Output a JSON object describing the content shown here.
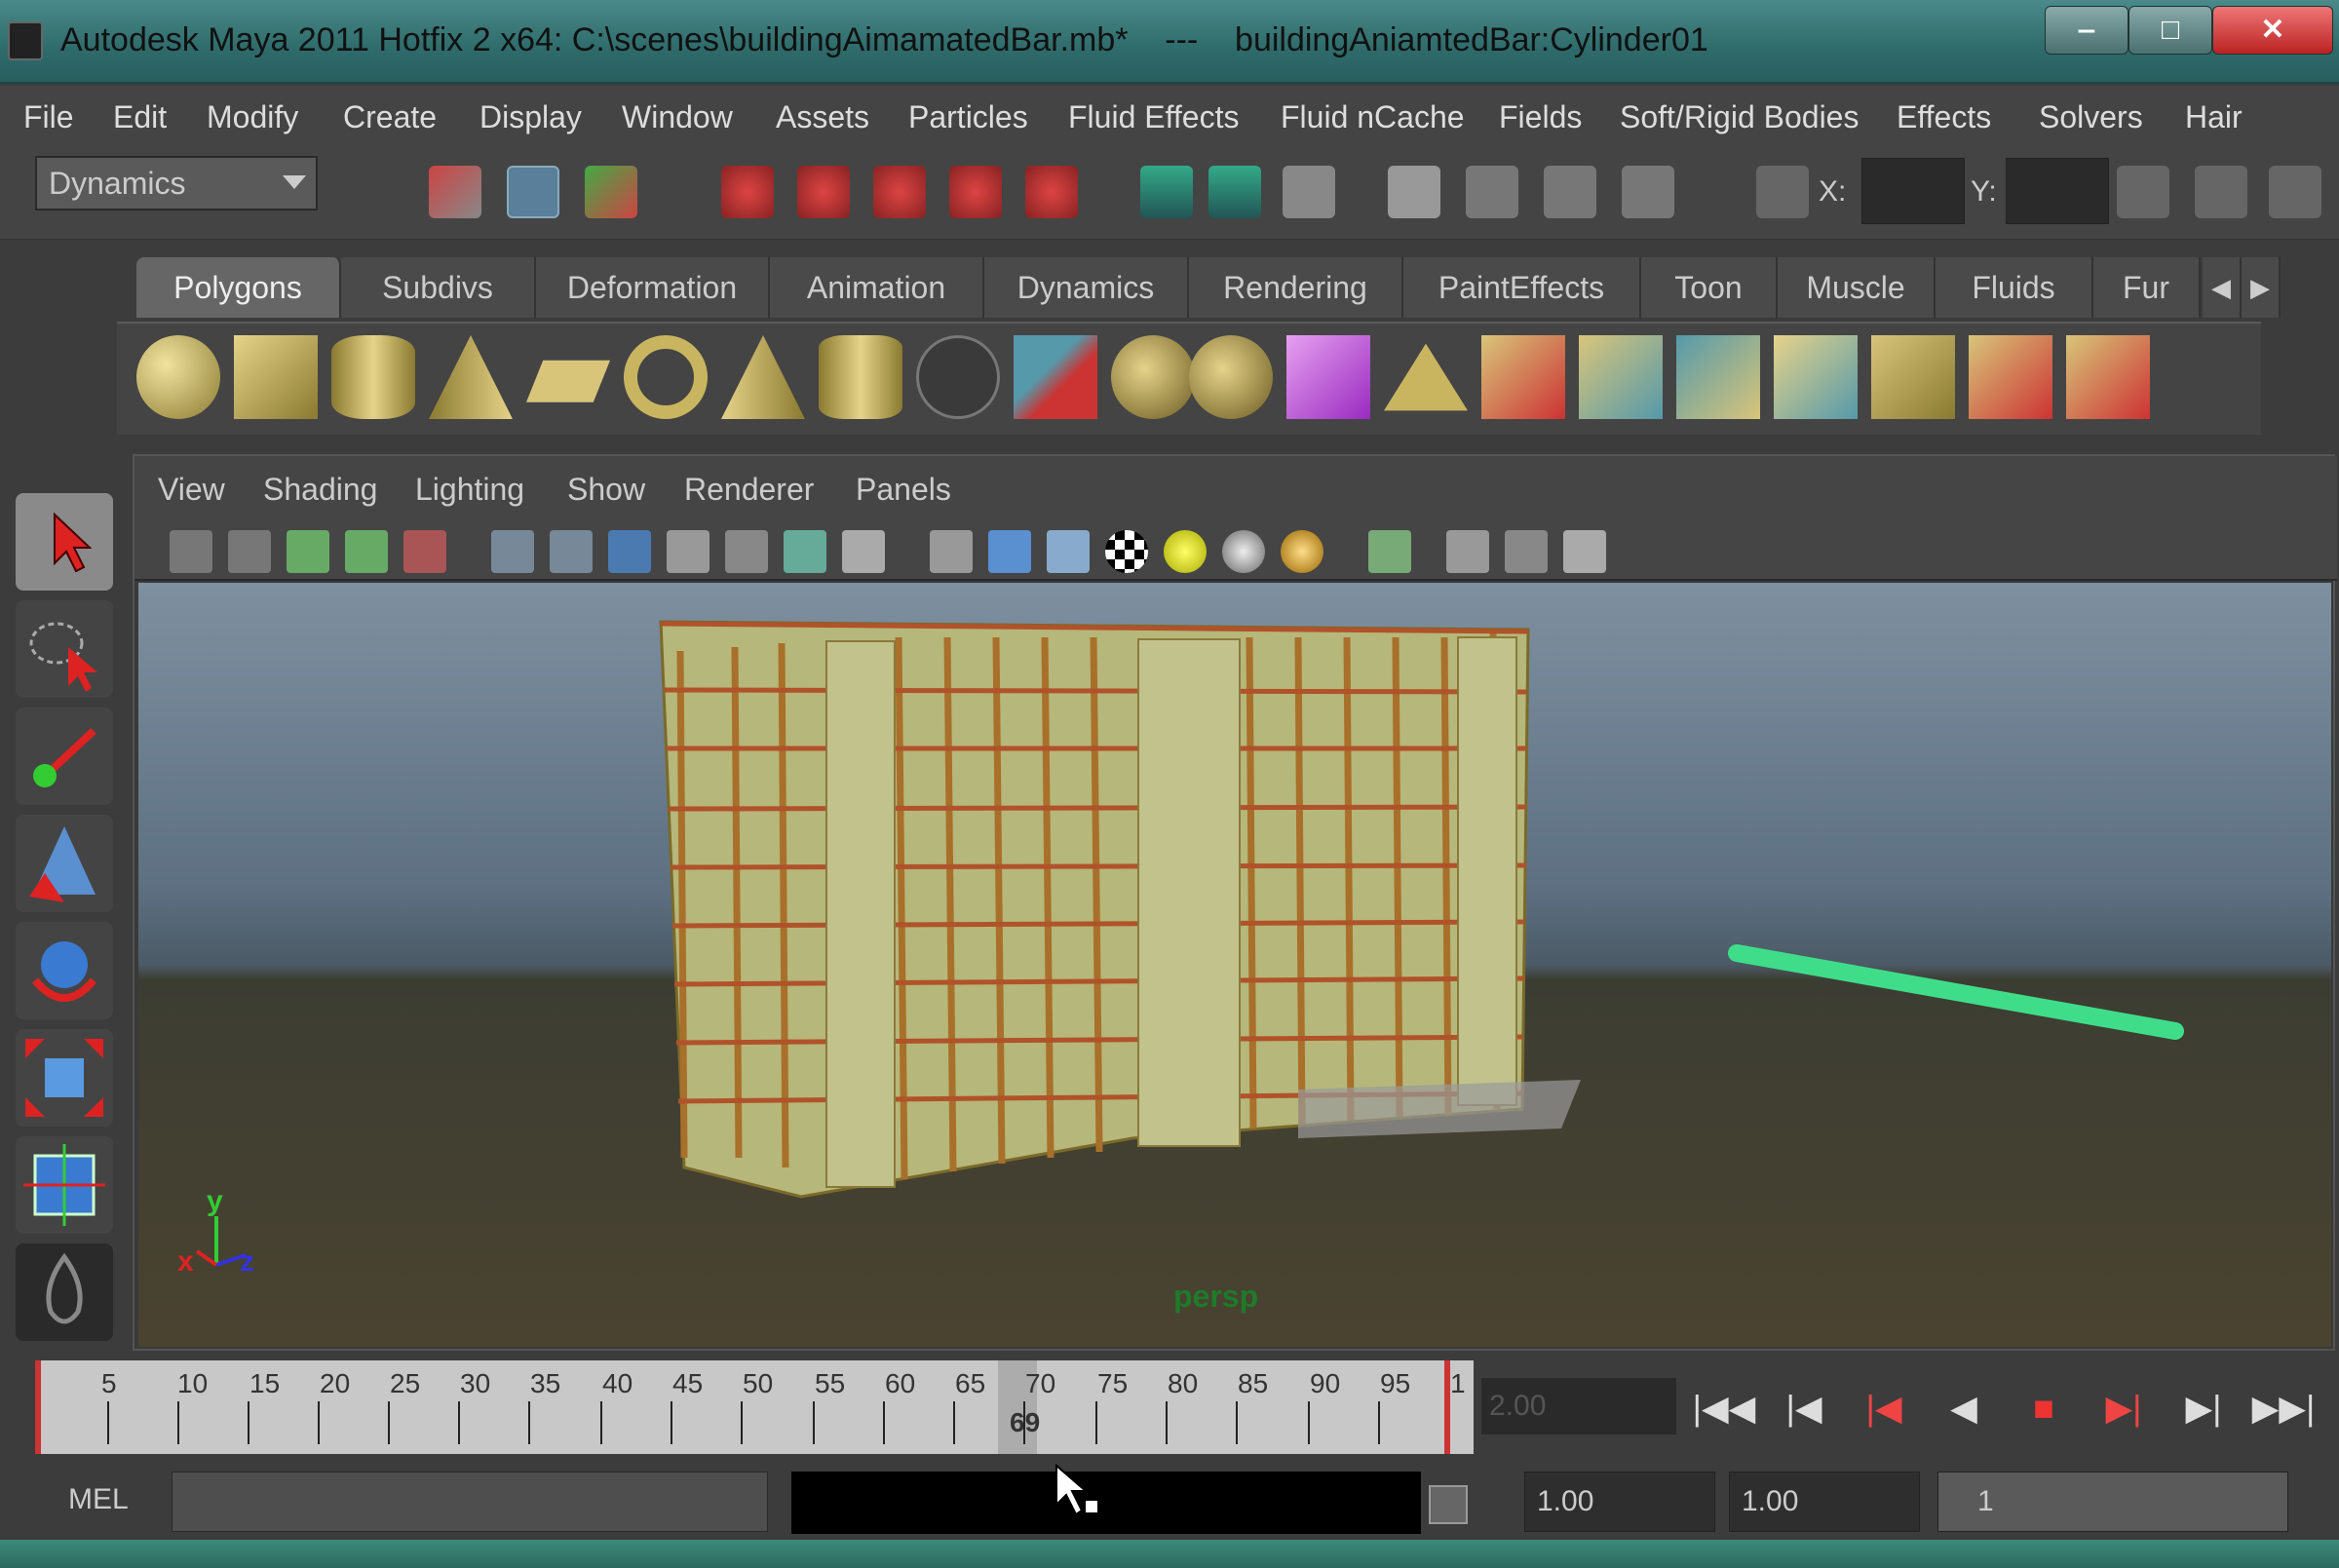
{
  "window": {
    "title": "Autodesk Maya 2011 Hotfix 2 x64: C:\\scenes\\buildingAimamatedBar.mb*    ---    buildingAniamtedBar:Cylinder01",
    "min_label": "‒",
    "max_label": "□",
    "close_label": "✕"
  },
  "menubar": {
    "items": [
      "File",
      "Edit",
      "Modify",
      "Create",
      "Display",
      "Window",
      "Assets",
      "Particles",
      "Fluid Effects",
      "Fluid nCache",
      "Fields",
      "Soft/Rigid Bodies",
      "Effects",
      "Solvers",
      "Hair"
    ]
  },
  "statusline": {
    "mode": "Dynamics",
    "x_label": "X:",
    "y_label": "Y:"
  },
  "shelf": {
    "tabs": [
      "Polygons",
      "Subdivs",
      "Deformation",
      "Animation",
      "Dynamics",
      "Rendering",
      "PaintEffects",
      "Toon",
      "Muscle",
      "Fluids",
      "Fur"
    ],
    "active_tab": "Polygons"
  },
  "panel": {
    "menu": [
      "View",
      "Shading",
      "Lighting",
      "Show",
      "Renderer",
      "Panels"
    ],
    "camera_label": "persp",
    "axis": {
      "x": "x",
      "y": "y",
      "z": "z"
    }
  },
  "timeline": {
    "ticks": [
      "5",
      "10",
      "15",
      "20",
      "25",
      "30",
      "35",
      "40",
      "45",
      "50",
      "55",
      "60",
      "65",
      "70",
      "75",
      "80",
      "85",
      "90",
      "95",
      "1"
    ],
    "current_frame": "69",
    "time_field": "2.00",
    "playback": [
      "|◀◀",
      "|◀",
      "|◀",
      "◀",
      "■",
      "▶|",
      "▶|",
      "▶▶|"
    ]
  },
  "cmdline": {
    "mel_label": "MEL",
    "range_start": "1.00",
    "range_end": "1.00",
    "range_slider": "1"
  },
  "colors": {
    "accent_teal": "#2f6b6b",
    "selected_bar": "#3fdd8a",
    "camera_label": "#1f7a2a"
  }
}
